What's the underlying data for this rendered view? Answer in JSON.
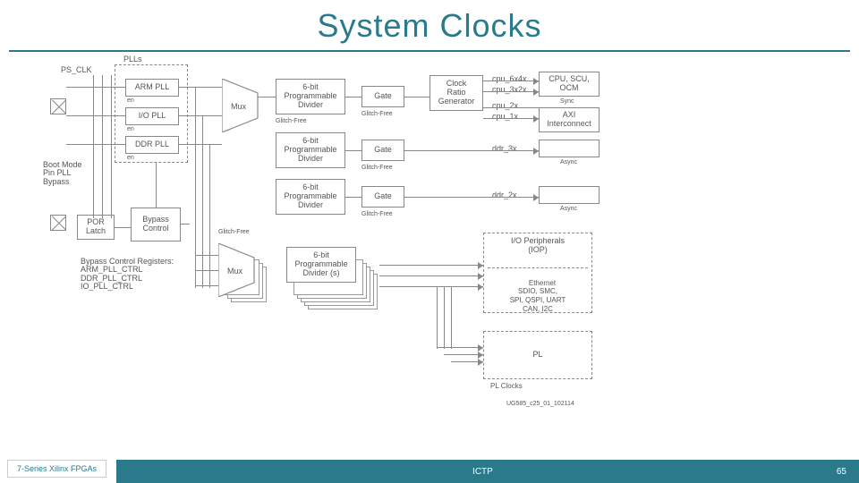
{
  "slide": {
    "title": "System Clocks",
    "footer_left": "7-Series Xilinx FPGAs",
    "footer_center": "ICTP",
    "page_number": "65"
  },
  "diagram": {
    "ps_clk": "PS_CLK",
    "plls_label": "PLLs",
    "arm_pll": "ARM PLL",
    "io_pll": "I/O PLL",
    "ddr_pll": "DDR PLL",
    "en": "en",
    "boot_mode": "Boot Mode\nPin PLL\nBypass",
    "por_latch": "POR\nLatch",
    "bypass_control": "Bypass\nControl",
    "bypass_registers": "Bypass Control Registers:\nARM_PLL_CTRL\nDDR_PLL_CTRL\nIO_PLL_CTRL",
    "mux": "Mux",
    "div6": "6-bit\nProgrammable\nDivider",
    "div6s": "6-bit\nProgrammable\nDivider (s)",
    "gate": "Gate",
    "glitch_free": "Glitch-Free",
    "clock_ratio_gen": "Clock\nRatio\nGenerator",
    "cpu_6x4x": "cpu_6x4x",
    "cpu_3x2x": "cpu_3x2x",
    "cpu_2x": "cpu_2x",
    "cpu_1x": "cpu_1x",
    "cpu_scu_ocm": "CPU, SCU,\nOCM",
    "sync": "Sync",
    "axi_interconnect": "AXI\nInterconnect",
    "ddr_3x": "ddr_3x",
    "ddr_2x": "ddr_2x",
    "async": "Async",
    "iop": "I/O Peripherals\n(IOP)",
    "iop_list": "Ethernet\nSDIO, SMC,\nSPI, QSPI, UART\nCAN, I2C",
    "pl": "PL",
    "pl_clocks": "PL Clocks",
    "fig_id": "UG585_c25_01_102114"
  }
}
